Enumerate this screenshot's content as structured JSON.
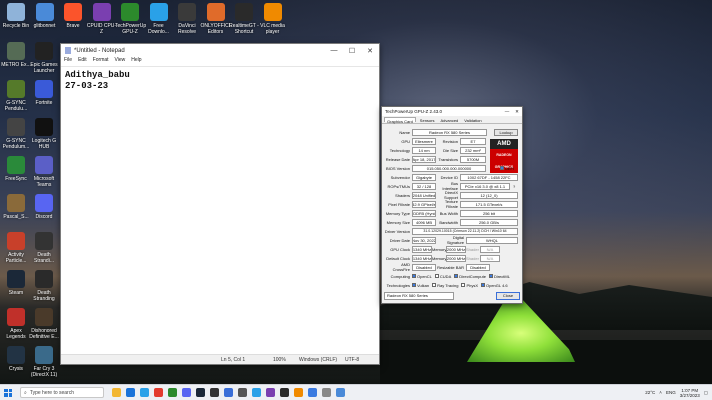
{
  "desktop_icons": [
    {
      "label": "Recycle Bin",
      "color": "#8fb3d9"
    },
    {
      "label": "glitbonnet",
      "color": "#4a8ad8"
    },
    {
      "label": "Brave",
      "color": "#fb542b"
    },
    {
      "label": "CPUID CPU-Z",
      "color": "#7a3fb0"
    },
    {
      "label": "TechPowerUp GPU-Z",
      "color": "#2c8a2c"
    },
    {
      "label": "Free Downlo...",
      "color": "#2aa1e8"
    },
    {
      "label": "DaVinci Resolve",
      "color": "#3a3a3a"
    },
    {
      "label": "ONLYOFFICE Editors",
      "color": "#e06b2a"
    },
    {
      "label": "RealtimeGT - Shortcut",
      "color": "#2a2a2a"
    },
    {
      "label": "VLC media player",
      "color": "#f08a00"
    },
    {
      "label": "METRO Ex...",
      "color": "#556b55"
    },
    {
      "label": "Epic Games Launcher",
      "color": "#222222"
    },
    {
      "label": "G-SYNC Pendulu...",
      "color": "#557a2a"
    },
    {
      "label": "Fortnite",
      "color": "#3a5ad8"
    },
    {
      "label": "G-SYNC Pendulum...",
      "color": "#444444"
    },
    {
      "label": "Logitech G HUB",
      "color": "#111111"
    },
    {
      "label": "FreeSync",
      "color": "#2a8a3a"
    },
    {
      "label": "Microsoft Teams",
      "color": "#5b5fc7"
    },
    {
      "label": "Pascal_S...",
      "color": "#8a6a3a"
    },
    {
      "label": "Discord",
      "color": "#5865f2"
    },
    {
      "label": "Activity Particle...",
      "color": "#c8402a"
    },
    {
      "label": "Death Strandi...",
      "color": "#333333"
    },
    {
      "label": "Steam",
      "color": "#1b2838"
    },
    {
      "label": "Death Stranding",
      "color": "#2a2a2a"
    },
    {
      "label": "Apex Legends",
      "color": "#c0302a"
    },
    {
      "label": "Dishonored Definitive E...",
      "color": "#4a3a2a"
    },
    {
      "label": "Crysis",
      "color": "#223344"
    },
    {
      "label": "Far Cry 3 (DirectX 11)",
      "color": "#3a6a8a"
    }
  ],
  "notepad": {
    "title": "*Untitled - Notepad",
    "menu": [
      "File",
      "Edit",
      "Format",
      "View",
      "Help"
    ],
    "lines": [
      "Adithya_babu",
      "27-03-23"
    ],
    "status": {
      "position": "Ln 5, Col 1",
      "zoom": "100%",
      "line_ending": "Windows (CRLF)",
      "encoding": "UTF-8"
    },
    "controls": {
      "minimize": "—",
      "maximize": "☐",
      "close": "✕"
    }
  },
  "gpuz": {
    "title": "TechPowerUp GPU-Z 2.43.0",
    "tabs": [
      "Graphics Card",
      "Sensors",
      "Advanced",
      "Validation"
    ],
    "lookup": "Lookup",
    "logo_text": "AMD",
    "logo_sub": "RADEON GRAPHICS",
    "name": "Radeon RX 580 Series",
    "gpu": "Ellesmere",
    "revision_label": "Revision",
    "revision": "E7",
    "technology": "14 nm",
    "die_size_label": "Die Size",
    "die_size": "232 mm²",
    "release_date": "Apr 18, 2017",
    "transistors_label": "Transistors",
    "transistors": "5700M",
    "bios_version": "015.050.000.000.000000",
    "uefi": "UEFI",
    "subvendor": "Gigabyte",
    "device_id_label": "Device ID",
    "device_id": "1002 67DF - 1458 22FC",
    "rops_tmus": "32 / 128",
    "bus_interface_label": "Bus Interface",
    "bus_interface": "PCIe x16 3.0 @ x8 1.1",
    "shaders": "2048 Unified",
    "directx_label": "DirectX Support",
    "directx": "12 (12_0)",
    "pixel_fillrate": "42.9 GPixel/s",
    "texture_fillrate_label": "Texture Fillrate",
    "texture_fillrate": "171.5 GTexel/s",
    "memory_type": "GDDR5 (Hynix)",
    "bus_width_label": "Bus Width",
    "bus_width": "256 bit",
    "memory_size": "4096 MB",
    "bandwidth_label": "Bandwidth",
    "bandwidth": "256.0 GB/s",
    "driver_version": "31.0.12029.10015 (Crimson 22.11.2) DCH / Win10 64",
    "driver_date": "Nov 30, 2022",
    "digital_signature_label": "Digital Signature",
    "digital_signature": "WHQL",
    "gpu_clock": "1340 MHz",
    "gpu_memory": "2000 MHz",
    "gpu_shader": "N/A",
    "default_clock": "1340 MHz",
    "default_memory": "2000 MHz",
    "default_shader": "N/A",
    "crossfire": "Disabled",
    "resizable_bar_label": "Resizable BAR",
    "resizable_bar": "Disabled",
    "computing": [
      {
        "name": "OpenCL",
        "on": true
      },
      {
        "name": "CUDA",
        "on": false
      },
      {
        "name": "DirectCompute",
        "on": true
      },
      {
        "name": "DirectML",
        "on": true
      }
    ],
    "technologies": [
      {
        "name": "Vulkan",
        "on": true
      },
      {
        "name": "Ray Tracing",
        "on": false
      },
      {
        "name": "PhysX",
        "on": false
      },
      {
        "name": "OpenGL 4.6",
        "on": true
      }
    ],
    "selected_card": "Radeon RX 580 Series",
    "close": "Close"
  },
  "taskbar": {
    "search_placeholder": "Type here to search",
    "pinned_colors": [
      "#f2b632",
      "#1a73d9",
      "#2aa1e8",
      "#e33b2e",
      "#2c8a2c",
      "#5865f2",
      "#1b2838",
      "#333333",
      "#3a6fd8",
      "#555555",
      "#2aa1e8",
      "#7a3fb0",
      "#2a2a2a",
      "#f08a00",
      "#3a7ae0",
      "#888888",
      "#4a8ad8"
    ],
    "weather": "22°C",
    "language": "ENG",
    "time": "1:07 PM",
    "date": "3/27/2023"
  }
}
